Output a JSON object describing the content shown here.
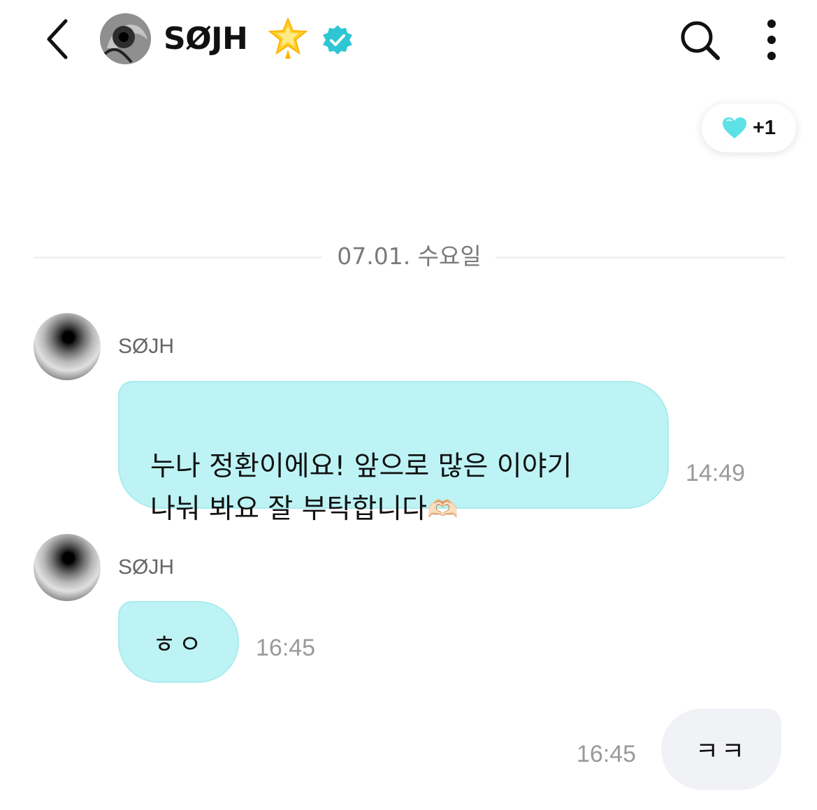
{
  "header": {
    "title": "SØJH",
    "star_icon": "glowing-star-icon",
    "verified_icon": "verified-badge-icon",
    "accent_color": "#2ec6d3"
  },
  "reaction": {
    "icon": "heart-icon",
    "count": "+1",
    "heart_color": "#5ce1e6"
  },
  "date_divider": {
    "text": "07.01. 수요일"
  },
  "messages": [
    {
      "sender": "SØJH",
      "text": "누나 정환이에요! 앞으로 많은 이야기\n나눠 봐요 잘 부탁합니다",
      "emoji": "🫶🏻",
      "time": "14:49"
    },
    {
      "sender": "SØJH",
      "text": "ㅎㅇ",
      "time": "16:45"
    },
    {
      "sender": "me",
      "text": "ㅋㅋ",
      "time": "16:45"
    }
  ],
  "colors": {
    "incoming_bubble": "#bdf3f4",
    "outgoing_bubble": "#f1f2f6"
  }
}
